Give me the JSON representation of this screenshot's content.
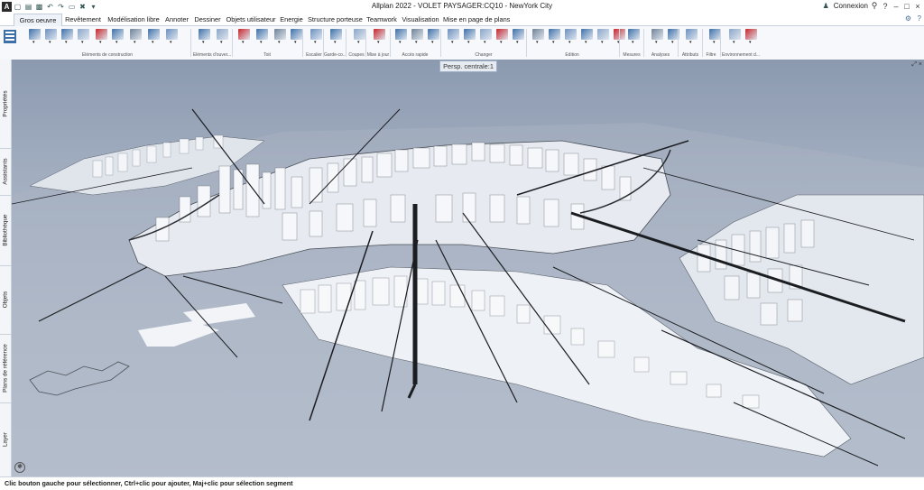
{
  "window": {
    "title": "Allplan 2022 - VOLET PAYSAGER:CQ10 - NewYork City",
    "app_logo": "A",
    "login_label": "Connexion",
    "login_icon": "user-icon",
    "controls": [
      "cart-icon",
      "help-icon",
      "minimize-icon",
      "maximize-icon",
      "close-icon"
    ]
  },
  "quick_access": [
    "new-file-icon",
    "open-file-icon",
    "save-icon",
    "undo-icon",
    "redo-icon",
    "print-icon",
    "tools-icon",
    "dropdown-icon"
  ],
  "tabs": [
    {
      "label": "Gros oeuvre",
      "active": true
    },
    {
      "label": "Revêtement"
    },
    {
      "label": "Modélisation libre"
    },
    {
      "label": "Annoter"
    },
    {
      "label": "Dessiner"
    },
    {
      "label": "Objets utilisateur"
    },
    {
      "label": "Energie"
    },
    {
      "label": "Structure porteuse"
    },
    {
      "label": "Teamwork"
    },
    {
      "label": "Visualisation"
    },
    {
      "label": "Mise en page de plans"
    }
  ],
  "ribbon_groups": [
    "Eléments de construction",
    "Eléments d'ouver...",
    "Toit",
    "Escalier",
    "Garde-co...",
    "Coupes",
    "Mise à jour",
    "Accès rapide",
    "Changer",
    "Edition",
    "Mesures",
    "Analyses",
    "Attributs",
    "Filtre",
    "Environnement d..."
  ],
  "sidebar_tabs": [
    "Propriétés",
    "Assistants",
    "Bibliothèque",
    "Objets",
    "Plans de référence",
    "Layer"
  ],
  "viewport": {
    "label": "Persp. centrale:1",
    "controls_text": "⤢ ×"
  },
  "status": "Clic bouton gauche pour sélectionner, Ctrl+clic pour ajouter, Maj+clic pour sélection segment",
  "colors": {
    "sky_top": "#8c9ab0",
    "sky_bottom": "#bcc5d2",
    "buildings": "#f2f4f7",
    "ribbon_bg": "#f6f8fb",
    "tab_active_bg": "#eef3f9",
    "accent_red": "#c8252b",
    "accent_blue": "#3d6fa8"
  }
}
